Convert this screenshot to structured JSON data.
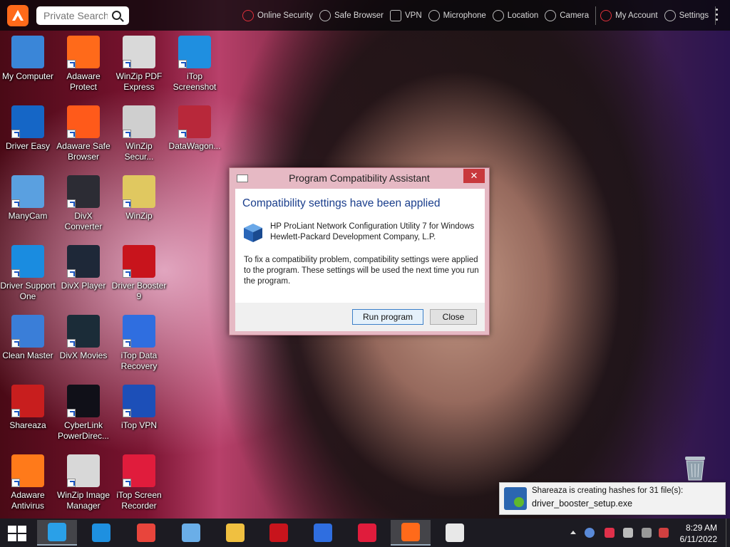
{
  "toolbar": {
    "search_placeholder": "Private Search",
    "items": [
      {
        "label": "Online Security",
        "icon": "globe-shield-icon"
      },
      {
        "label": "Safe Browser",
        "icon": "safe-browser-icon"
      },
      {
        "label": "VPN",
        "icon": "vpn-shield-icon"
      },
      {
        "label": "Microphone",
        "icon": "microphone-off-icon"
      },
      {
        "label": "Location",
        "icon": "location-pin-icon"
      },
      {
        "label": "Camera",
        "icon": "camera-icon"
      },
      {
        "label": "My Account",
        "icon": "user-icon"
      },
      {
        "label": "Settings",
        "icon": "gear-icon"
      }
    ]
  },
  "desktop_icons": [
    {
      "label": "My Computer",
      "color": "#3a86d8",
      "icon": "computer-icon"
    },
    {
      "label": "Adaware Protect",
      "color": "#ff6a1a",
      "icon": "adaware-icon"
    },
    {
      "label": "WinZip PDF Express",
      "color": "#d9d9d9",
      "icon": "winzip-pdf-icon"
    },
    {
      "label": "iTop Screenshot",
      "color": "#1f8fe0",
      "icon": "camera-icon"
    },
    {
      "label": "Driver Easy",
      "color": "#1566c6",
      "icon": "driver-easy-icon"
    },
    {
      "label": "Adaware Safe Browser",
      "color": "#ff5a1a",
      "icon": "adaware-browser-icon"
    },
    {
      "label": "WinZip Secur...",
      "color": "#cfcfcf",
      "icon": "winzip-secure-icon"
    },
    {
      "label": "DataWagon...",
      "color": "#b8283a",
      "icon": "datawagon-icon"
    },
    {
      "label": "ManyCam",
      "color": "#5aa0e0",
      "icon": "manycam-icon"
    },
    {
      "label": "DivX Converter",
      "color": "#2c2c34",
      "icon": "divx-converter-icon"
    },
    {
      "label": "WinZip",
      "color": "#e0c860",
      "icon": "winzip-icon"
    },
    {
      "label": "Driver Support One",
      "color": "#1a8ce0",
      "icon": "driver-support-icon"
    },
    {
      "label": "DivX Player",
      "color": "#1e2838",
      "icon": "divx-player-icon"
    },
    {
      "label": "Driver Booster 9",
      "color": "#c8141c",
      "icon": "driver-booster-icon"
    },
    {
      "label": "Clean Master",
      "color": "#3a7ed8",
      "icon": "broom-icon"
    },
    {
      "label": "DivX Movies",
      "color": "#1b2c38",
      "icon": "divx-movies-icon"
    },
    {
      "label": "iTop Data Recovery",
      "color": "#2f6ee0",
      "icon": "data-recovery-icon"
    },
    {
      "label": "Shareaza",
      "color": "#c81e1e",
      "icon": "shareaza-icon"
    },
    {
      "label": "CyberLink PowerDirec...",
      "color": "#101018",
      "icon": "powerdirector-icon"
    },
    {
      "label": "iTop VPN",
      "color": "#1c4fb8",
      "icon": "vpn-icon"
    },
    {
      "label": "Adaware Antivirus",
      "color": "#ff7a1a",
      "icon": "adaware-antivirus-icon"
    },
    {
      "label": "WinZip Image Manager",
      "color": "#d8d8d8",
      "icon": "winzip-image-icon"
    },
    {
      "label": "iTop Screen Recorder",
      "color": "#e01c3c",
      "icon": "screen-recorder-icon"
    }
  ],
  "dialog": {
    "title": "Program Compatibility Assistant",
    "heading": "Compatibility settings have been applied",
    "program_name": "HP ProLiant Network Configuration Utility 7 for Windows",
    "publisher": "Hewlett-Packard Development Company, L.P.",
    "description": "To fix a compatibility problem, compatibility settings were applied to the program.  These settings will be used the next time you run the program.",
    "run_label": "Run program",
    "close_label": "Close",
    "close_glyph": "✕"
  },
  "toast": {
    "line1": "Shareaza is creating hashes for 31 file(s):",
    "line2": "driver_booster_setup.exe"
  },
  "taskbar": {
    "apps": [
      {
        "name": "skype-taskbar",
        "color": "#2aa0e8",
        "active": true
      },
      {
        "name": "skype-alt-taskbar",
        "color": "#1e90e0",
        "active": false
      },
      {
        "name": "chrome-taskbar",
        "color": "#e8453c",
        "active": false
      },
      {
        "name": "manycam-taskbar",
        "color": "#6aaee8",
        "active": false
      },
      {
        "name": "file-explorer-taskbar",
        "color": "#f0c040",
        "active": false
      },
      {
        "name": "driver-booster-taskbar",
        "color": "#c8141c",
        "active": false
      },
      {
        "name": "data-recovery-taskbar",
        "color": "#2f6ee0",
        "active": false
      },
      {
        "name": "screen-recorder-taskbar",
        "color": "#e01c3c",
        "active": false
      },
      {
        "name": "adaware-taskbar",
        "color": "#ff6a1a",
        "active": true
      },
      {
        "name": "list-app-taskbar",
        "color": "#e8e8e8",
        "active": false
      }
    ],
    "time": "8:29 AM",
    "date": "6/11/2022"
  }
}
